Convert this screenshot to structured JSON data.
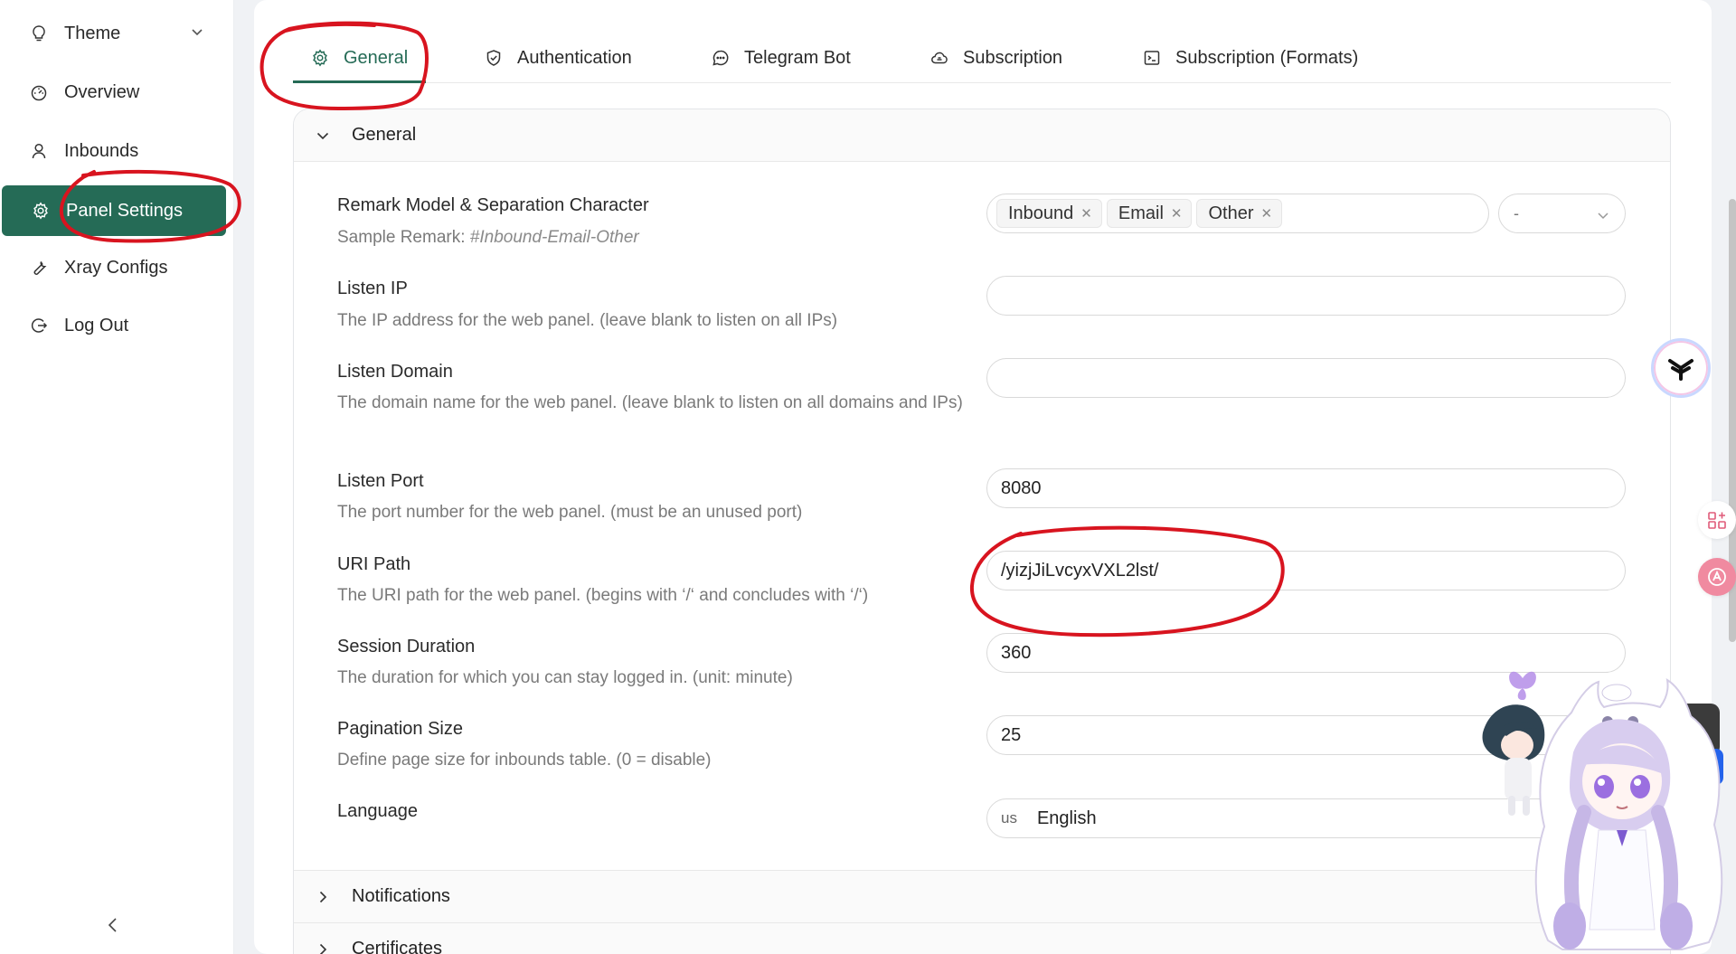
{
  "sidebar": {
    "items": [
      {
        "label": "Theme",
        "icon": "bulb-icon"
      },
      {
        "label": "Overview",
        "icon": "dashboard-icon"
      },
      {
        "label": "Inbounds",
        "icon": "user-icon"
      },
      {
        "label": "Panel Settings",
        "icon": "gear-icon",
        "active": true
      },
      {
        "label": "Xray Configs",
        "icon": "tool-icon"
      },
      {
        "label": "Log Out",
        "icon": "logout-icon"
      }
    ],
    "collapse_glyph": "<"
  },
  "tabs": [
    {
      "label": "General",
      "icon": "gear-icon",
      "active": true
    },
    {
      "label": "Authentication",
      "icon": "shield-icon"
    },
    {
      "label": "Telegram Bot",
      "icon": "message-icon"
    },
    {
      "label": "Subscription",
      "icon": "cloud-icon"
    },
    {
      "label": "Subscription (Formats)",
      "icon": "code-icon"
    }
  ],
  "general": {
    "header": "General",
    "remark": {
      "title": "Remark Model & Separation Character",
      "desc_prefix": "Sample Remark: ",
      "desc_sample": "#Inbound-Email-Other",
      "tags": [
        "Inbound",
        "Email",
        "Other"
      ],
      "separator": "-"
    },
    "listen_ip": {
      "title": "Listen IP",
      "desc": "The IP address for the web panel. (leave blank to listen on all IPs)",
      "value": ""
    },
    "listen_domain": {
      "title": "Listen Domain",
      "desc": "The domain name for the web panel. (leave blank to listen on all domains and IPs)",
      "value": ""
    },
    "listen_port": {
      "title": "Listen Port",
      "desc": "The port number for the web panel. (must be an unused port)",
      "value": "8080"
    },
    "uri_path": {
      "title": "URI Path",
      "desc": "The URI path for the web panel. (begins with ‘/‘ and concludes with ‘/‘)",
      "value": "/yizjJiLvcyxVXL2lst/"
    },
    "session_duration": {
      "title": "Session Duration",
      "desc": "The duration for which you can stay logged in. (unit: minute)",
      "value": "360"
    },
    "pagination_size": {
      "title": "Pagination Size",
      "desc": "Define page size for inbounds table. (0 = disable)",
      "value": "25"
    },
    "language": {
      "title": "Language",
      "flag": "us",
      "value": "English"
    }
  },
  "sections": {
    "notifications": "Notifications",
    "certificates": "Certificates"
  },
  "colors": {
    "accent": "#256b56",
    "annotation": "#d8141f"
  }
}
